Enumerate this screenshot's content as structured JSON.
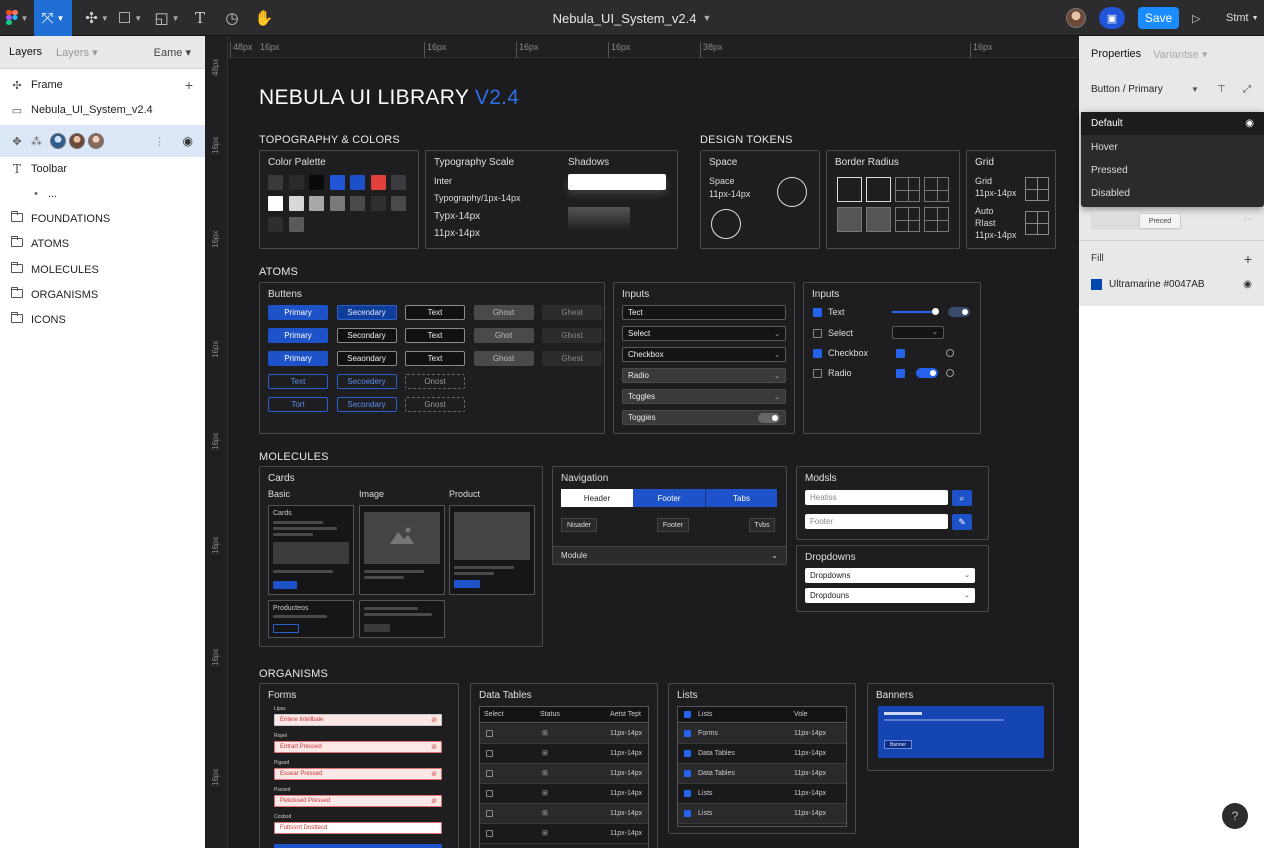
{
  "app": {
    "title": "Nebula_UI_System_v2.4",
    "save_label": "Save",
    "share_label": "Stmt"
  },
  "left_panel": {
    "tabs": [
      "Layers",
      "Layers",
      "Eame"
    ],
    "frame_label": "Frame",
    "file_name": "Nebula_UI_System_v2.4",
    "toolbar_label": "Toolbar",
    "toolbar_child": "...",
    "groups": [
      "FOUNDATIONS",
      "ATOMS",
      "MOLECULES",
      "ORGANISMS",
      "ICONS"
    ]
  },
  "rulers": {
    "top": [
      "48px",
      "16px",
      "16px",
      "16px",
      "16px",
      "38px",
      "16px"
    ],
    "left": [
      "48px",
      "16px",
      "16px",
      "16px",
      "16px",
      "16px",
      "16px",
      "16px"
    ]
  },
  "canvas": {
    "title_main": "NEBULA UI LIBRARY",
    "title_version": "V2.4",
    "typography_colors": "TOPOGRAPHY & COLORS",
    "color_palette": "Color Palette",
    "palette_colors": [
      "#3a3a3c",
      "#2a2a2c",
      "#0a0a0a",
      "#1f55d6",
      "#1d4fc8",
      "#e0403a",
      "#3c3c3e",
      "#ffffff",
      "#d8d8d8",
      "#a8a8a8",
      "#7a7a7a",
      "#4a4a4c",
      "#2f2f31",
      "#4a4a4c",
      "#2e2e30",
      "#5a5a5c"
    ],
    "typography_scale": "Typography Scale",
    "type_items": [
      "Inter",
      "Typography/1px-14px",
      "Typx-14px",
      "11px-14px"
    ],
    "shadows": "Shadows",
    "design_tokens": "DESIGN TOKENS",
    "space": {
      "title": "Space",
      "l1": "Space",
      "l2": "11px-14px"
    },
    "border_radius": "Border Radius",
    "grid": {
      "title": "Grid",
      "l1": "Grid",
      "l2": "11px-14px",
      "l3": "Auto",
      "l4": "Rlast",
      "l5": "11px-14px"
    },
    "atoms": "ATOMS",
    "buttons": {
      "title": "Buttens",
      "rows": [
        [
          "Primary",
          "Secendary",
          "Text",
          "Ghost",
          "Ghest"
        ],
        [
          "Primary",
          "Secondary",
          "Text",
          "Ghot",
          "Ghost"
        ],
        [
          "Primary",
          "Seaondary",
          "Text",
          "Ghost",
          "Ghest"
        ],
        [
          "Text",
          "Secoedery",
          "Onost"
        ],
        [
          "Tort",
          "Secondary",
          "Gnost"
        ]
      ]
    },
    "inputs1": {
      "title": "Inputs",
      "fields": [
        "Tect",
        "Select",
        "Checkbox",
        "Radio",
        "Tcggles",
        "Toggies"
      ]
    },
    "inputs2": {
      "title": "Inputs",
      "items": [
        "Text",
        "Select",
        "Checkbox",
        "Radio"
      ]
    },
    "molecules": "MOLECULES",
    "cards": {
      "title": "Cards",
      "labels": [
        "Basic",
        "Image",
        "Product"
      ],
      "card_label": "Cards",
      "prod_label": "Producteos"
    },
    "navigation": {
      "title": "Navigation",
      "tabs": [
        "Header",
        "Footer",
        "Tabs"
      ],
      "row2": [
        "Nisader",
        "Footer",
        "Tvbs"
      ],
      "module": "Module"
    },
    "modals": {
      "title": "Modsls",
      "f1": "Heatiss",
      "f2": "Footer"
    },
    "dropdowns": {
      "title": "Dropdowns",
      "d1": "Dropdowns",
      "d2": "Dropdouns"
    },
    "organisms": "ORGANISMS",
    "forms": {
      "title": "Forms",
      "labels": [
        "Lipss",
        "Ropel",
        "Pigsed",
        "Psssed",
        "Cosbod"
      ],
      "fields": [
        "Entere Intellbale",
        "Entrart Pressed",
        "Essear Pressed",
        "Pekossed Pressed",
        "Futtssrrt Dosttecd"
      ]
    },
    "data_tables": {
      "title": "Data Tables",
      "headers": [
        "Select",
        "Status",
        "Aetst Tept"
      ],
      "rows": [
        "11px-14px",
        "11px-14px",
        "11px-14px",
        "11px-14px",
        "11px-14px",
        "11px-14px"
      ]
    },
    "lists": {
      "title": "Lists",
      "header": [
        "Lists",
        "Vole"
      ],
      "items": [
        "Forms",
        "Data Tables",
        "Data Tables",
        "Lists",
        "Lists"
      ],
      "values": [
        "11px-14px",
        "11px-14px",
        "11px-14px",
        "11px-14px",
        "11px-14px"
      ]
    },
    "banners": {
      "title": "Banners",
      "button": "Banner"
    }
  },
  "right_panel": {
    "title": "Properties",
    "subtitle": "Variantse",
    "component": "Button / Primary",
    "states": [
      "Default",
      "Hover",
      "Pressed",
      "Disabled"
    ],
    "pressed_chip": "Preced",
    "fill_label": "Fill",
    "fill_value": "Ultramarine #0047AB",
    "fill_color": "#0047AB"
  }
}
